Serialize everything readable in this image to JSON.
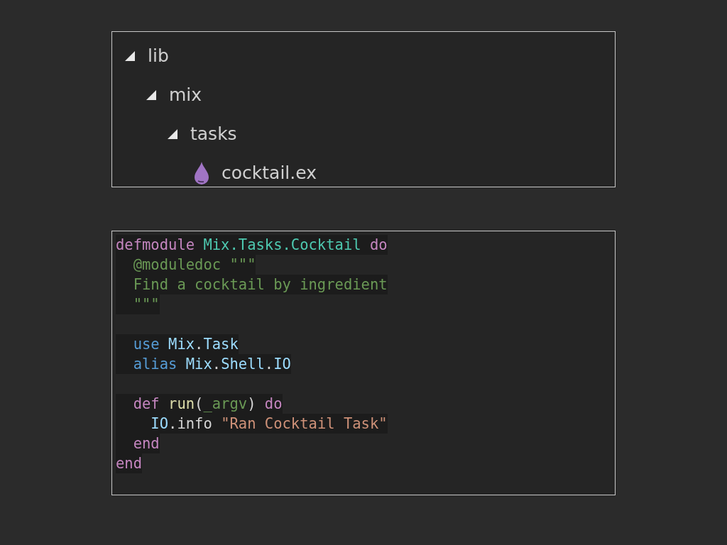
{
  "file_tree": [
    {
      "label": "lib",
      "kind": "folder",
      "expanded": true,
      "children": [
        {
          "label": "mix",
          "kind": "folder",
          "expanded": true,
          "children": [
            {
              "label": "tasks",
              "kind": "folder",
              "expanded": true,
              "children": [
                {
                  "label": "cocktail.ex",
                  "kind": "file"
                }
              ]
            }
          ]
        }
      ]
    }
  ],
  "code_lines": [
    {
      "kind": "code",
      "tokens": [
        {
          "text": "defmodule ",
          "kind": "keyword"
        },
        {
          "text": "Mix.Tasks.Cocktail ",
          "kind": "module"
        },
        {
          "text": "do",
          "kind": "keyword"
        }
      ]
    },
    {
      "kind": "code",
      "tokens": [
        {
          "text": "  @moduledoc \"\"\"",
          "kind": "doc"
        }
      ]
    },
    {
      "kind": "code",
      "tokens": [
        {
          "text": "  Find a cocktail by ingredient",
          "kind": "doc"
        }
      ]
    },
    {
      "kind": "code",
      "tokens": [
        {
          "text": "  \"\"\"",
          "kind": "doc"
        }
      ]
    },
    {
      "kind": "blank"
    },
    {
      "kind": "code",
      "tokens": [
        {
          "text": "  use ",
          "kind": "builtin"
        },
        {
          "text": "Mix",
          "kind": "name"
        },
        {
          "text": ".",
          "kind": "plain"
        },
        {
          "text": "Task",
          "kind": "name"
        }
      ]
    },
    {
      "kind": "code",
      "tokens": [
        {
          "text": "  alias ",
          "kind": "builtin"
        },
        {
          "text": "Mix",
          "kind": "name"
        },
        {
          "text": ".",
          "kind": "plain"
        },
        {
          "text": "Shell",
          "kind": "name"
        },
        {
          "text": ".",
          "kind": "plain"
        },
        {
          "text": "IO",
          "kind": "name"
        }
      ]
    },
    {
      "kind": "blank"
    },
    {
      "kind": "code",
      "tokens": [
        {
          "text": "  def ",
          "kind": "keyword"
        },
        {
          "text": "run",
          "kind": "function"
        },
        {
          "text": "(",
          "kind": "plain"
        },
        {
          "text": "_argv",
          "kind": "variable"
        },
        {
          "text": ") ",
          "kind": "plain"
        },
        {
          "text": "do",
          "kind": "keyword"
        }
      ]
    },
    {
      "kind": "code",
      "tokens": [
        {
          "text": "    IO",
          "kind": "name"
        },
        {
          "text": ".info ",
          "kind": "plain"
        },
        {
          "text": "\"Ran Cocktail Task\"",
          "kind": "string"
        }
      ]
    },
    {
      "kind": "code",
      "tokens": [
        {
          "text": "  end",
          "kind": "keyword"
        }
      ]
    },
    {
      "kind": "code",
      "tokens": [
        {
          "text": "end",
          "kind": "keyword"
        }
      ]
    }
  ]
}
